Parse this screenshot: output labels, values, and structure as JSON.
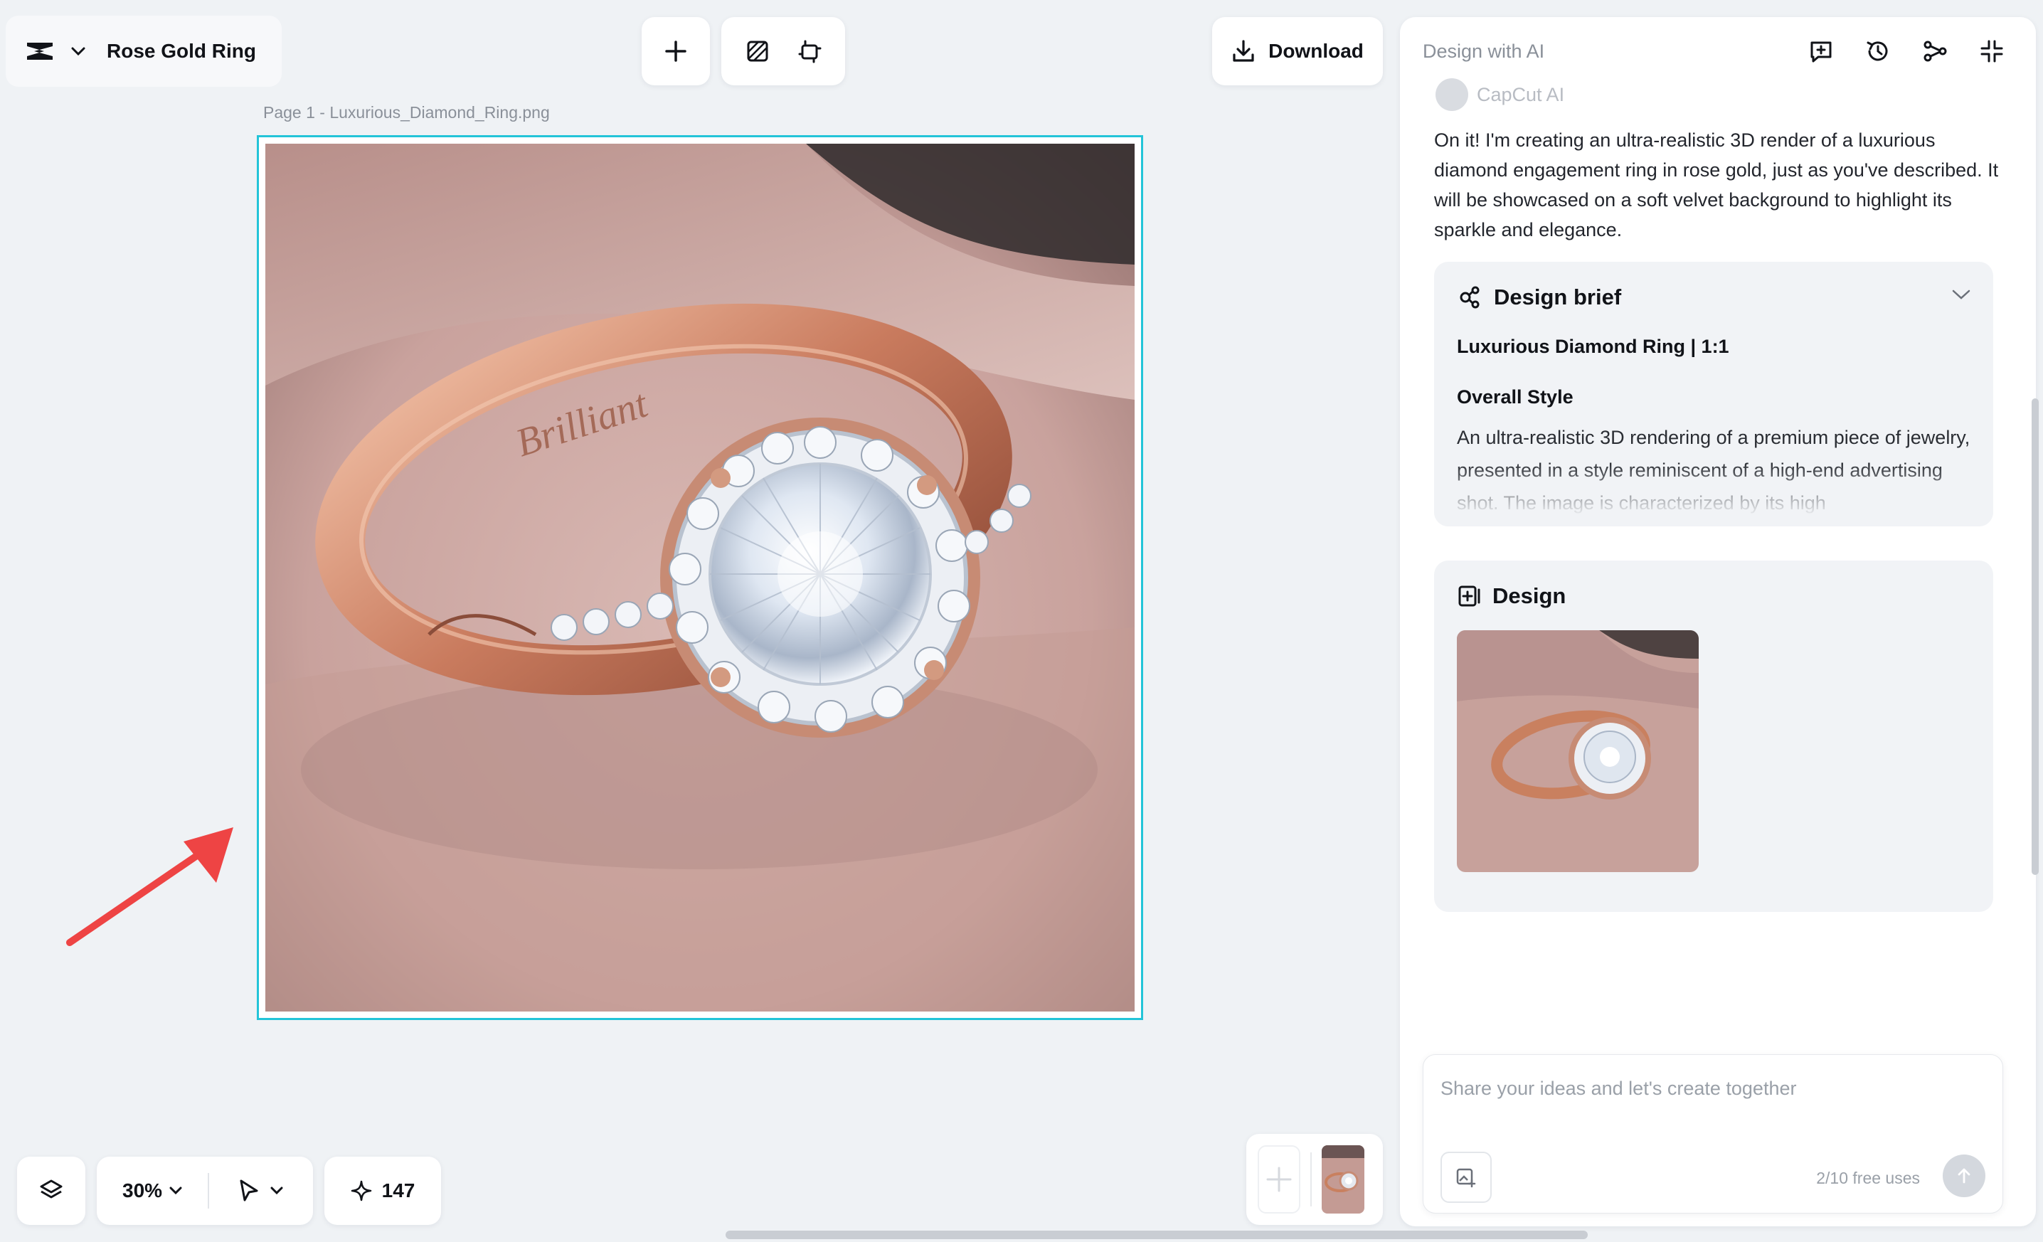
{
  "app": {
    "project_name": "Rose Gold Ring"
  },
  "toolbar": {
    "download_label": "Download"
  },
  "canvas": {
    "page_label": "Page 1 -  Luxurious_Diamond_Ring.png",
    "engraving": "Brilliant"
  },
  "panel": {
    "title": "Design with AI",
    "assistant_name": "CapCut AI",
    "message": "On it! I'm creating an ultra-realistic 3D render of a luxurious diamond engagement ring in rose gold, just as you've described. It will be showcased on a soft velvet background to highlight its sparkle and elegance.",
    "brief": {
      "title": "Design brief",
      "meta": "Luxurious Diamond Ring | 1:1",
      "style_heading": "Overall Style",
      "style_text": "An ultra-realistic 3D rendering of a premium piece of jewelry, presented in a style reminiscent of a high-end advertising shot. The image is characterized by its high"
    },
    "design": {
      "title": "Design"
    },
    "prompt": {
      "placeholder": "Share your ideas and let's create together",
      "free_uses": "2/10 free uses"
    }
  },
  "bottom": {
    "zoom": "30%",
    "credits": "147"
  },
  "colors": {
    "selection": "#23c4d8",
    "annotation_arrow": "#ee4444",
    "canvas_bg": "#eff2f5"
  },
  "icons": [
    "capcut-logo-icon",
    "chevron-down-icon",
    "plus-icon",
    "remove-background-icon",
    "resize-icon",
    "download-icon",
    "new-chat-icon",
    "history-icon",
    "share-icon",
    "collapse-icon",
    "design-brief-icon",
    "design-icon",
    "upload-image-icon",
    "send-arrow-icon",
    "layers-icon",
    "pointer-icon",
    "sparkle-icon"
  ]
}
